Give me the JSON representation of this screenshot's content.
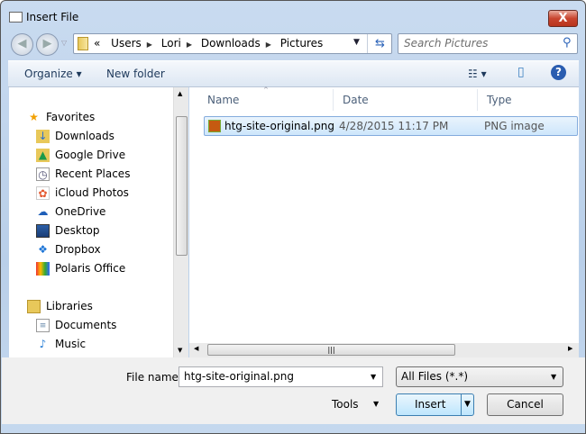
{
  "window": {
    "title": "Insert File",
    "close_label": "X"
  },
  "address": {
    "crumbs": [
      "«",
      "Users",
      "Lori",
      "Downloads",
      "Pictures"
    ],
    "search_placeholder": "Search Pictures"
  },
  "toolbar": {
    "organize": "Organize ▾",
    "new_folder": "New folder",
    "views": "☷ ▾",
    "preview": "▯",
    "help": "?"
  },
  "nav": {
    "favorites": {
      "label": "Favorites",
      "items": [
        {
          "label": "Downloads",
          "icon": "downloads-folder-icon"
        },
        {
          "label": "Google Drive",
          "icon": "google-drive-icon"
        },
        {
          "label": "Recent Places",
          "icon": "recent-places-icon"
        },
        {
          "label": "iCloud Photos",
          "icon": "icloud-photos-icon"
        },
        {
          "label": "OneDrive",
          "icon": "onedrive-icon"
        },
        {
          "label": "Desktop",
          "icon": "desktop-icon"
        },
        {
          "label": "Dropbox",
          "icon": "dropbox-icon"
        },
        {
          "label": "Polaris Office",
          "icon": "polaris-office-icon"
        }
      ]
    },
    "libraries": {
      "label": "Libraries",
      "items": [
        {
          "label": "Documents",
          "icon": "documents-icon"
        },
        {
          "label": "Music",
          "icon": "music-icon"
        }
      ]
    }
  },
  "list": {
    "columns": [
      "Name",
      "Date",
      "Type"
    ],
    "rows": [
      {
        "name": "htg-site-original.png",
        "date": "4/28/2015 11:17 PM",
        "type": "PNG image",
        "selected": true
      }
    ]
  },
  "bottom": {
    "file_name_label": "File name:",
    "file_name_value": "htg-site-original.png",
    "file_type": "All Files (*.*)",
    "tools": "Tools",
    "insert": "Insert",
    "cancel": "Cancel"
  }
}
